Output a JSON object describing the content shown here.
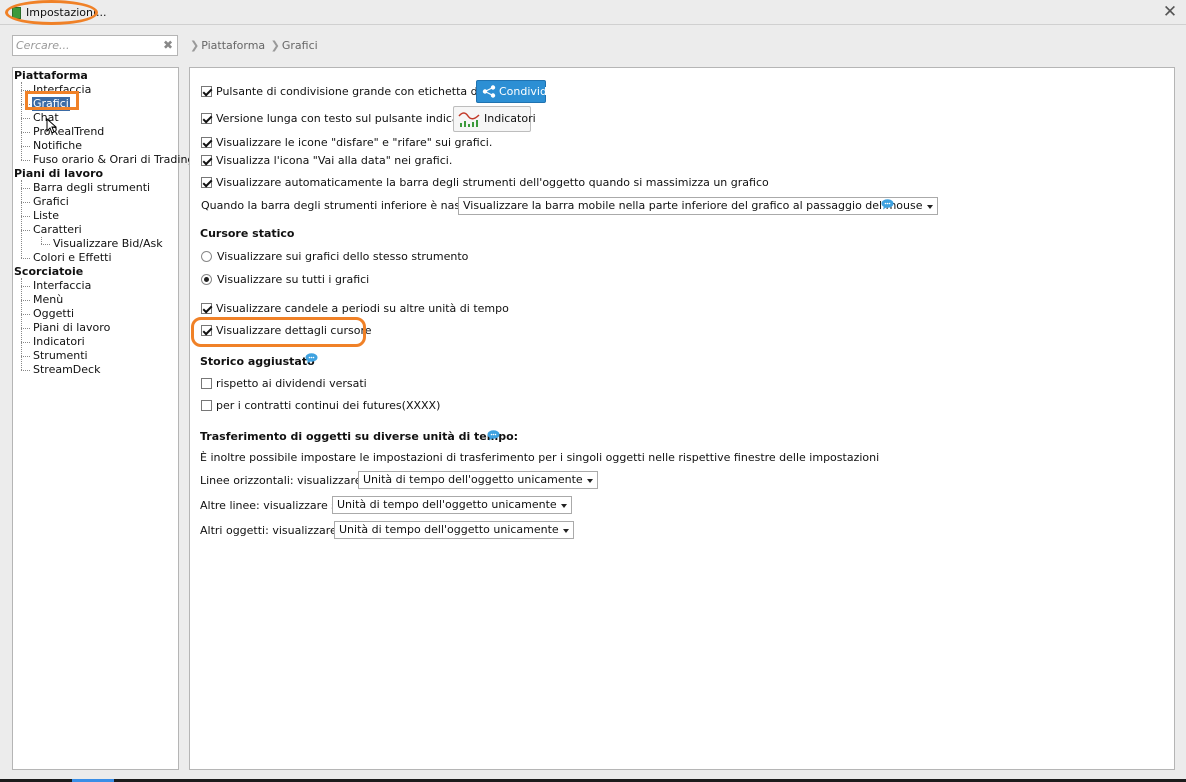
{
  "window": {
    "title": "Impostazioni..."
  },
  "search": {
    "placeholder": "Cercare..."
  },
  "breadcrumb": [
    "Piattaforma",
    "Grafici"
  ],
  "tree": {
    "piattaforma": {
      "label": "Piattaforma",
      "items": [
        "Interfaccia",
        "Grafici",
        "Chat",
        "ProRealTrend",
        "Notifiche",
        "Fuso orario & Orari di Trading"
      ]
    },
    "piani": {
      "label": "Piani di lavoro",
      "items": [
        "Barra degli strumenti",
        "Grafici",
        "Liste",
        "Caratteri",
        "Visualizzare Bid/Ask",
        "Colori e Effetti"
      ]
    },
    "scorciatoie": {
      "label": "Scorciatoie",
      "items": [
        "Interfaccia",
        "Menù",
        "Oggetti",
        "Piani di lavoro",
        "Indicatori",
        "Strumenti",
        "StreamDeck"
      ]
    }
  },
  "settings": {
    "share_label": "Pulsante di condivisione grande con etichetta di testo",
    "share_button": "Condividi",
    "long_label": "Versione lunga con testo sul pulsante indicatore",
    "indicator_button": "Indicatori",
    "undo_redo": "Visualizzare le icone \"disfare\" e \"rifare\"  sui grafici.",
    "goto_date": "Visualizza l'icona \"Vai alla data\" nei grafici.",
    "auto_toolbar": "Visualizzare automaticamente la barra degli strumenti dell'oggetto quando si massimizza un grafico",
    "hidden_toolbar_label": "Quando la barra degli strumenti inferiore è nascosta:",
    "hidden_toolbar_value": "Visualizzare la barra mobile nella parte inferiore del grafico al passaggio del mouse",
    "static_cursor_heading": "Cursore statico",
    "radio_same": "Visualizzare sui grafici dello stesso strumento",
    "radio_all": "Visualizzare su tutti i grafici",
    "candles": "Visualizzare candele a periodi su altre unità di tempo",
    "cursor_details": "Visualizzare dettagli cursore",
    "history_heading": "Storico aggiustato",
    "dividends": "rispetto ai dividendi versati",
    "futures": "per i contratti continui dei futures(XXXX)",
    "transfer_heading": "Trasferimento di oggetti su diverse unità di tempo:",
    "transfer_note": "È inoltre possibile impostare le impostazioni di trasferimento per i singoli oggetti nelle rispettive finestre delle impostazioni",
    "horiz_label": "Linee orizzontali: visualizzare in",
    "horiz_value": "Unità di tempo dell'oggetto unicamente",
    "other_lines_label": "Altre linee: visualizzare su",
    "other_lines_value": "Unità di tempo dell'oggetto unicamente",
    "other_objects_label": "Altri oggetti: visualizzare in",
    "other_objects_value": "Unità di tempo dell'oggetto unicamente"
  },
  "colors": {
    "accent_orange": "#f08127",
    "share_blue": "#2c8fd4",
    "selection_blue": "#3b6ba5"
  }
}
